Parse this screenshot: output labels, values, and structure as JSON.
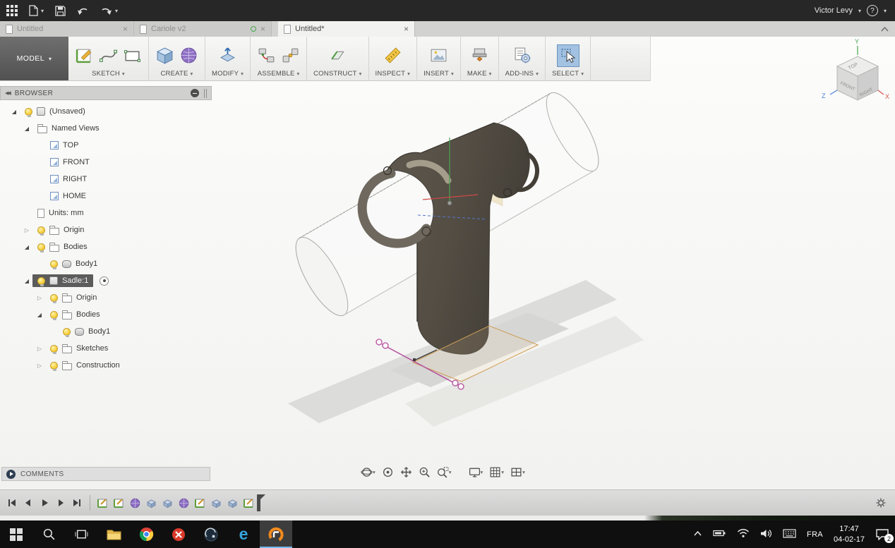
{
  "titlebar": {
    "user": "Victor Levy",
    "help": "?"
  },
  "tabs": {
    "items": [
      {
        "label": "Untitled"
      },
      {
        "label": "Cariole v2"
      },
      {
        "label": "Untitled*"
      }
    ]
  },
  "ribbon": {
    "workspace": "MODEL",
    "groups": [
      {
        "label": "SKETCH"
      },
      {
        "label": "CREATE"
      },
      {
        "label": "MODIFY"
      },
      {
        "label": "ASSEMBLE"
      },
      {
        "label": "CONSTRUCT"
      },
      {
        "label": "INSPECT"
      },
      {
        "label": "INSERT"
      },
      {
        "label": "MAKE"
      },
      {
        "label": "ADD-INS"
      },
      {
        "label": "SELECT"
      }
    ]
  },
  "viewcube": {
    "top": "TOP",
    "front": "FRONT",
    "right": "RIGHT",
    "axis_x": "X",
    "axis_y": "Y",
    "axis_z": "Z"
  },
  "browser": {
    "title": "BROWSER",
    "tree": [
      {
        "label": "(Unsaved)"
      },
      {
        "label": "Named Views"
      },
      {
        "label": "TOP"
      },
      {
        "label": "FRONT"
      },
      {
        "label": "RIGHT"
      },
      {
        "label": "HOME"
      },
      {
        "label": "Units: mm"
      },
      {
        "label": "Origin"
      },
      {
        "label": "Bodies"
      },
      {
        "label": "Body1"
      },
      {
        "label": "Sadle:1"
      },
      {
        "label": "Origin"
      },
      {
        "label": "Bodies"
      },
      {
        "label": "Body1"
      },
      {
        "label": "Sketches"
      },
      {
        "label": "Construction"
      }
    ]
  },
  "comments": {
    "label": "COMMENTS"
  },
  "timeline": {
    "features": [
      "sketch",
      "sketch",
      "form",
      "extrude",
      "extrude",
      "form",
      "sketch",
      "extrude",
      "extrude",
      "sketch"
    ]
  },
  "taskbar": {
    "language": "FRA",
    "time": "17:47",
    "date": "04-02-17",
    "notifications": "2"
  }
}
